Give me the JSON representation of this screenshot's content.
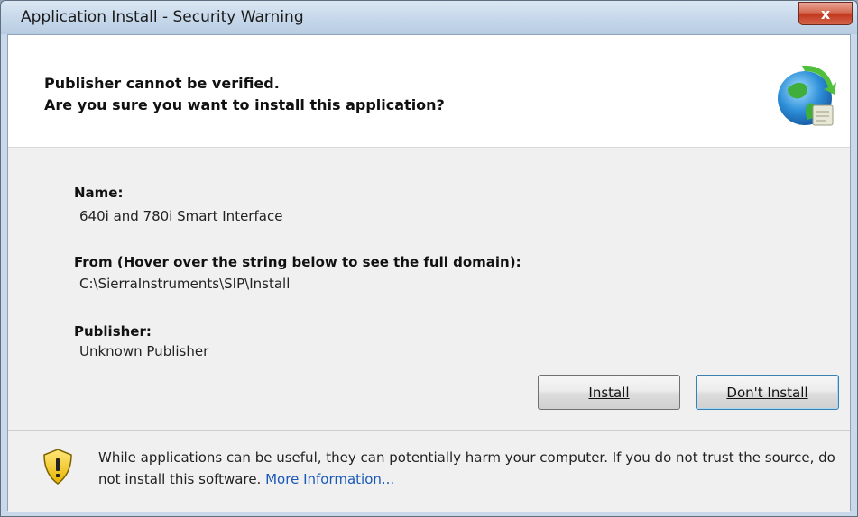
{
  "window": {
    "title": "Application Install - Security Warning",
    "close_label": "x"
  },
  "header": {
    "line1": "Publisher cannot be verified.",
    "line2": "Are you sure you want to install this application?",
    "icon": "globe-install-icon"
  },
  "details": {
    "name_label": "Name:",
    "name_value": "640i and 780i Smart Interface",
    "from_label": "From (Hover over the string below to see the full domain):",
    "from_value": "C:\\SierraInstruments\\SIP\\Install",
    "publisher_label": "Publisher:",
    "publisher_value": "Unknown Publisher"
  },
  "buttons": {
    "install": "Install",
    "dont_install": "Don't Install"
  },
  "footer": {
    "icon": "warning-shield-icon",
    "warning_text": "While applications can be useful, they can potentially harm your computer. If you do not trust the source, do not install this software.",
    "link_text": "More Information..."
  },
  "colors": {
    "accent": "#1a58b8",
    "close_button": "#c2381e"
  }
}
